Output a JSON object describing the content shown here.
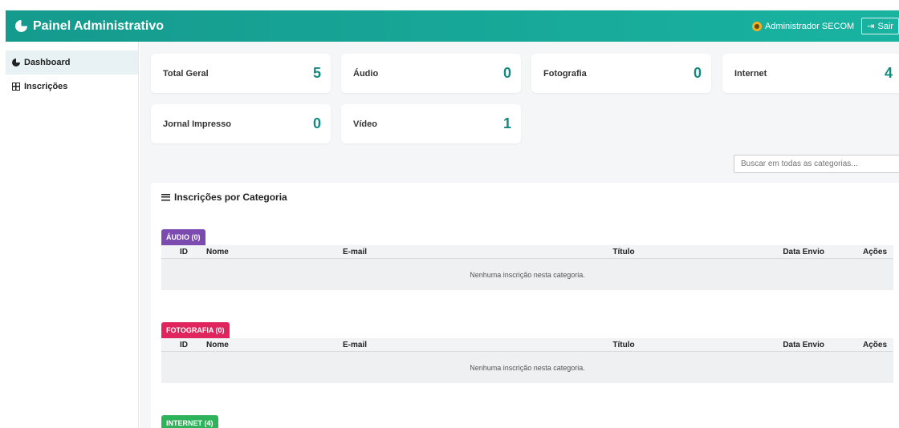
{
  "header": {
    "title": "Painel Administrativo",
    "user": "Administrador SECOM",
    "logout_label": "Sair"
  },
  "sidebar": {
    "items": [
      {
        "label": "Dashboard",
        "icon": "pie-chart-icon",
        "active": true
      },
      {
        "label": "Inscrições",
        "icon": "table-icon",
        "active": false
      }
    ]
  },
  "stats": [
    {
      "label": "Total Geral",
      "value": "5"
    },
    {
      "label": "Áudio",
      "value": "0"
    },
    {
      "label": "Fotografia",
      "value": "0"
    },
    {
      "label": "Internet",
      "value": "4"
    },
    {
      "label": "Jornal Impresso",
      "value": "0"
    },
    {
      "label": "Vídeo",
      "value": "1"
    }
  ],
  "search": {
    "placeholder": "Buscar em todas as categorias..."
  },
  "panel": {
    "title": "Inscrições por Categoria"
  },
  "table_headers": [
    "ID",
    "Nome",
    "E-mail",
    "Título",
    "Data Envio",
    "Ações"
  ],
  "categories": [
    {
      "badge": "ÁUDIO (0)",
      "color": "#7b4bb0",
      "empty_text": "Nenhuma inscrição nesta categoria."
    },
    {
      "badge": "FOTOGRAFIA (0)",
      "color": "#e0245e",
      "empty_text": "Nenhuma inscrição nesta categoria."
    },
    {
      "badge": "INTERNET (4)",
      "color": "#2fb35a"
    }
  ],
  "colors": {
    "accent": "#159a8e",
    "value": "#138a80"
  }
}
